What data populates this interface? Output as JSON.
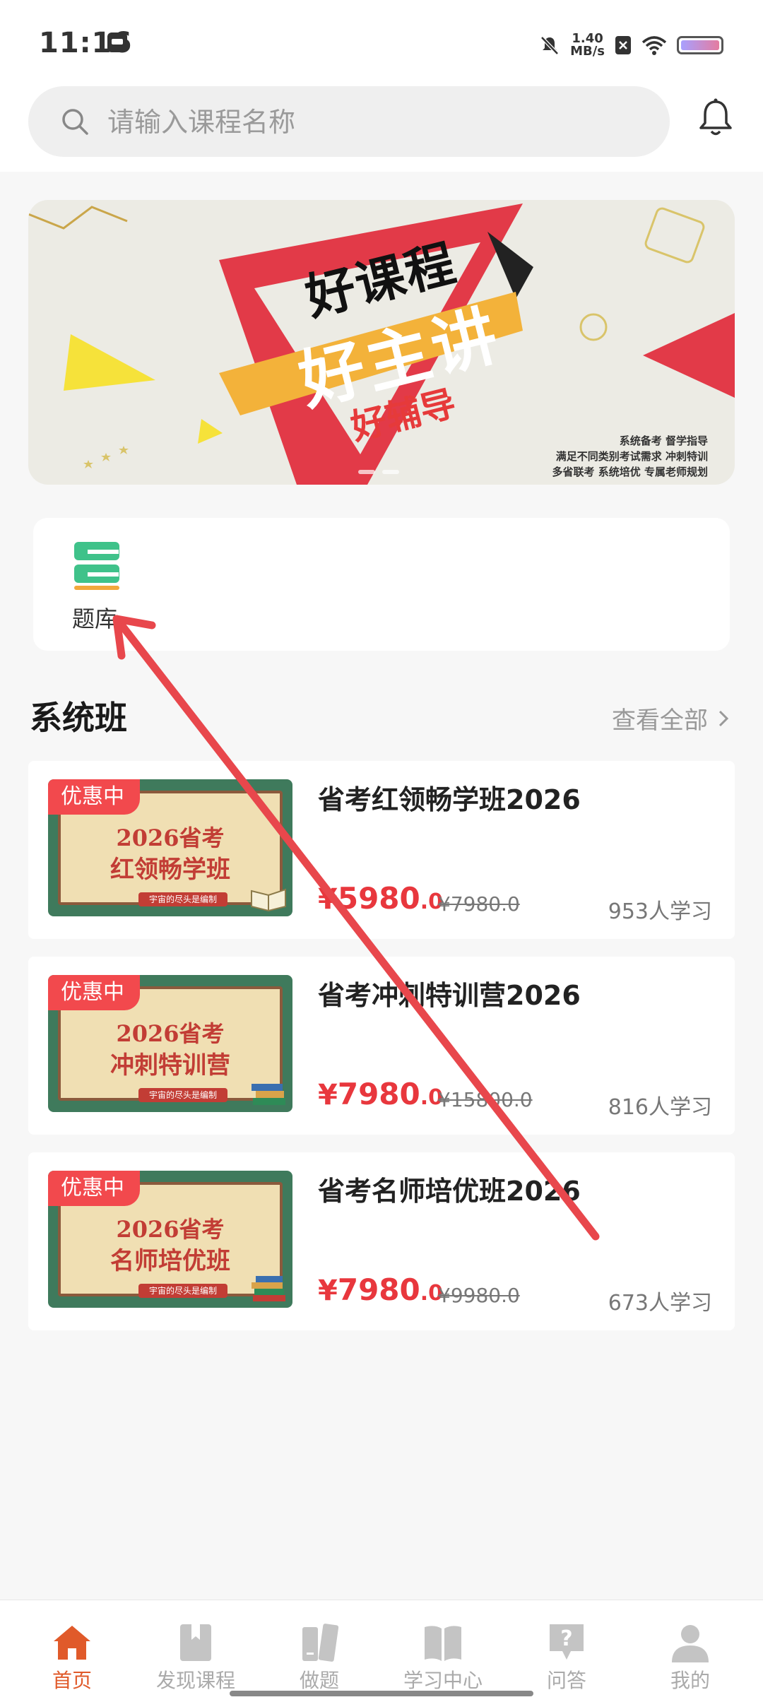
{
  "status_bar": {
    "time": "11:16",
    "speed_value": "1.40",
    "speed_unit": "MB/s"
  },
  "search": {
    "placeholder": "请输入课程名称"
  },
  "banner": {
    "title_line1": "好课程",
    "title_line2": "好主讲",
    "title_line3": "好辅导",
    "tag_lines": [
      "系统备考 督学指导",
      "满足不同类别考试需求 冲刺特训",
      "多省联考 系统培优 专属老师规划"
    ]
  },
  "quick_entries": [
    {
      "label": "题库",
      "icon": "question-bank-icon"
    }
  ],
  "section": {
    "title": "系统班",
    "view_all": "查看全部"
  },
  "courses": [
    {
      "badge": "优惠中",
      "thumb_line1": "2026省考",
      "thumb_line2": "红领畅学班",
      "thumb_ribbon": "宇宙的尽头是编制",
      "title": "省考红领畅学班2026",
      "price_yen": "¥",
      "price_int": "5980",
      "price_dec": ".0",
      "orig_price": "¥7980.0",
      "learners": "953人学习"
    },
    {
      "badge": "优惠中",
      "thumb_line1": "2026省考",
      "thumb_line2": "冲刺特训营",
      "thumb_ribbon": "宇宙的尽头是编制",
      "title": "省考冲刺特训营2026",
      "price_yen": "¥",
      "price_int": "7980",
      "price_dec": ".0",
      "orig_price": "¥15800.0",
      "learners": "816人学习"
    },
    {
      "badge": "优惠中",
      "thumb_line1": "2026省考",
      "thumb_line2": "名师培优班",
      "thumb_ribbon": "宇宙的尽头是编制",
      "title": "省考名师培优班2026",
      "price_yen": "¥",
      "price_int": "7980",
      "price_dec": ".0",
      "orig_price": "¥9980.0",
      "learners": "673人学习"
    }
  ],
  "bottom_nav": [
    {
      "label": "首页",
      "icon": "home-icon",
      "active": true
    },
    {
      "label": "发现课程",
      "icon": "bookmark-book-icon",
      "active": false
    },
    {
      "label": "做题",
      "icon": "notebook-icon",
      "active": false
    },
    {
      "label": "学习中心",
      "icon": "open-book-icon",
      "active": false
    },
    {
      "label": "问答",
      "icon": "question-bubble-icon",
      "active": false
    },
    {
      "label": "我的",
      "icon": "user-icon",
      "active": false
    }
  ],
  "colors": {
    "accent": "#e05a2a",
    "price": "#e8373d",
    "badge": "#f2494d",
    "annotation_arrow": "#e8474c"
  }
}
